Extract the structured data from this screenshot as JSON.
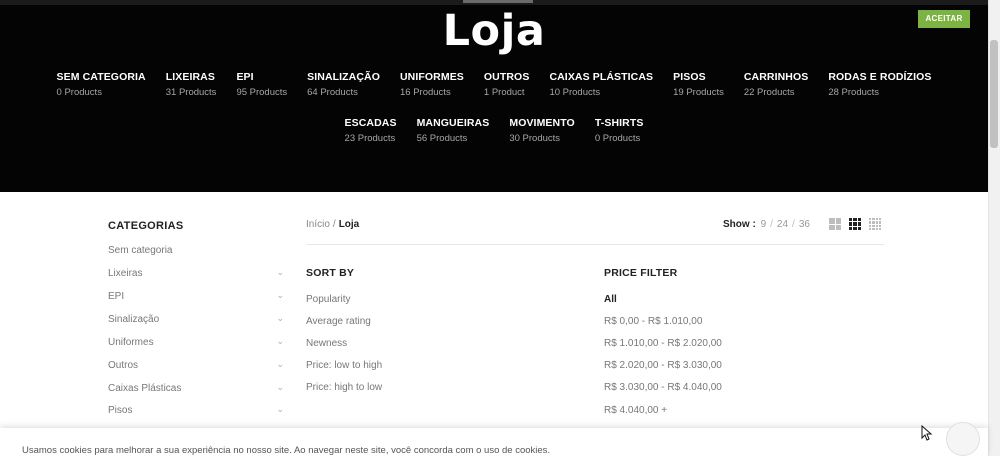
{
  "hero": {
    "title": "Loja",
    "row1": [
      {
        "name": "SEM CATEGORIA",
        "count": "0 Products"
      },
      {
        "name": "LIXEIRAS",
        "count": "31 Products"
      },
      {
        "name": "EPI",
        "count": "95 Products"
      },
      {
        "name": "SINALIZAÇÃO",
        "count": "64 Products"
      },
      {
        "name": "UNIFORMES",
        "count": "16 Products"
      },
      {
        "name": "OUTROS",
        "count": "1 Product"
      },
      {
        "name": "CAIXAS PLÁSTICAS",
        "count": "10 Products"
      },
      {
        "name": "PISOS",
        "count": "19 Products"
      },
      {
        "name": "CARRINHOS",
        "count": "22 Products"
      },
      {
        "name": "RODAS E RODÍZIOS",
        "count": "28 Products"
      }
    ],
    "row2": [
      {
        "name": "ESCADAS",
        "count": "23 Products"
      },
      {
        "name": "MANGUEIRAS",
        "count": "56 Products"
      },
      {
        "name": "MOVIMENTO",
        "count": "30 Products"
      },
      {
        "name": "T-SHIRTS",
        "count": "0 Products"
      }
    ]
  },
  "sidebar": {
    "title": "CATEGORIAS",
    "items": [
      {
        "label": "Sem categoria",
        "expandable": false
      },
      {
        "label": "Lixeiras",
        "expandable": true
      },
      {
        "label": "EPI",
        "expandable": true
      },
      {
        "label": "Sinalização",
        "expandable": true
      },
      {
        "label": "Uniformes",
        "expandable": true
      },
      {
        "label": "Outros",
        "expandable": true
      },
      {
        "label": "Caixas Plásticas",
        "expandable": true
      },
      {
        "label": "Pisos",
        "expandable": true
      }
    ],
    "chevron": "⌄"
  },
  "breadcrumb": {
    "home": "Início",
    "separator": "/",
    "current": "Loja"
  },
  "show": {
    "label": "Show :",
    "options": [
      "9",
      "24",
      "36"
    ],
    "separator": "/"
  },
  "sort": {
    "title": "SORT BY",
    "items": [
      "Popularity",
      "Average rating",
      "Newness",
      "Price: low to high",
      "Price: high to low"
    ]
  },
  "price": {
    "title": "PRICE FILTER",
    "items": [
      "All",
      "R$ 0,00 - R$ 1.010,00",
      "R$ 1.010,00 - R$ 2.020,00",
      "R$ 2.020,00 - R$ 3.030,00",
      "R$ 3.030,00 - R$ 4.040,00",
      "R$ 4.040,00 +"
    ],
    "active_index": 0
  },
  "cookie": {
    "text": "Usamos cookies para melhorar a sua experiência no nosso site. Ao navegar neste site, você concorda com o uso de cookies.",
    "button": "ACEITAR",
    "button_color": "#7cb342"
  },
  "grid_views": {
    "active": "3-columns"
  }
}
